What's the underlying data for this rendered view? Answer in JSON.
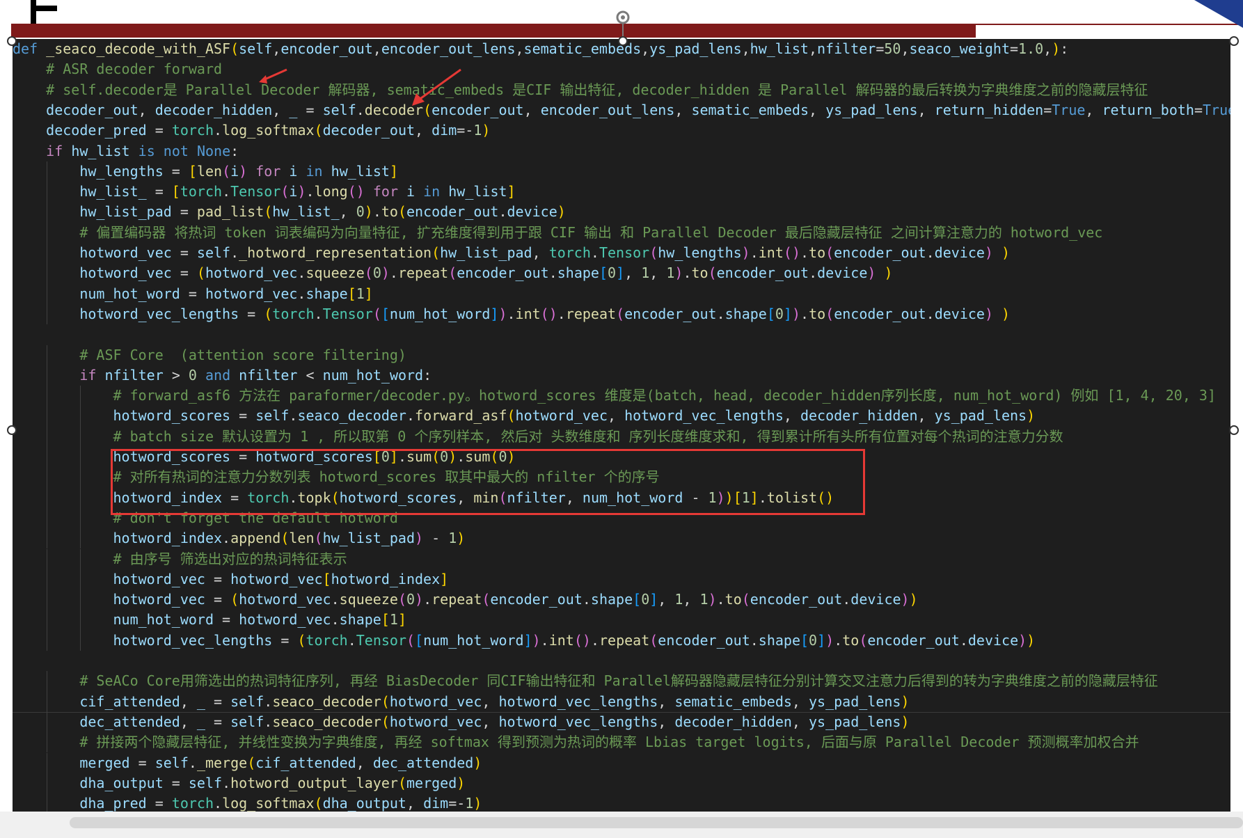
{
  "window": {
    "title_glyph": "F"
  },
  "code": {
    "lines": [
      {
        "text": "def _seaco_decode_with_ASF(self,encoder_out,encoder_out_lens,sematic_embeds,ys_pad_lens,hw_list,nfilter=50,seaco_weight=1.0,):"
      },
      {
        "text": "    # ASR decoder forward"
      },
      {
        "text": "    # self.decoder是 Parallel Decoder 解码器, sematic_embeds 是CIF 输出特征, decoder_hidden 是 Parallel 解码器的最后转换为字典维度之前的隐藏层特征"
      },
      {
        "text": "    decoder_out, decoder_hidden, _ = self.decoder(encoder_out, encoder_out_lens, sematic_embeds, ys_pad_lens, return_hidden=True, return_both=True)"
      },
      {
        "text": "    decoder_pred = torch.log_softmax(decoder_out, dim=-1)"
      },
      {
        "text": "    if hw_list is not None:"
      },
      {
        "text": "        hw_lengths = [len(i) for i in hw_list]"
      },
      {
        "text": "        hw_list_ = [torch.Tensor(i).long() for i in hw_list]"
      },
      {
        "text": "        hw_list_pad = pad_list(hw_list_, 0).to(encoder_out.device)"
      },
      {
        "text": "        # 偏置编码器 将热词 token 词表编码为向量特征, 扩充维度得到用于跟 CIF 输出 和 Parallel Decoder 最后隐藏层特征 之间计算注意力的 hotword_vec"
      },
      {
        "text": "        hotword_vec = self._hotword_representation(hw_list_pad, torch.Tensor(hw_lengths).int().to(encoder_out.device) )"
      },
      {
        "text": "        hotword_vec = (hotword_vec.squeeze(0).repeat(encoder_out.shape[0], 1, 1).to(encoder_out.device) )"
      },
      {
        "text": "        num_hot_word = hotword_vec.shape[1]"
      },
      {
        "text": "        hotword_vec_lengths = (torch.Tensor([num_hot_word]).int().repeat(encoder_out.shape[0]).to(encoder_out.device) )"
      },
      {
        "text": ""
      },
      {
        "text": "        # ASF Core  (attention score filtering)"
      },
      {
        "text": "        if nfilter > 0 and nfilter < num_hot_word:"
      },
      {
        "text": "            # forward_asf6 方法在 paraformer/decoder.py。hotword_scores 维度是(batch, head, decoder_hidden序列长度, num_hot_word) 例如 [1, 4, 20, 3]"
      },
      {
        "text": "            hotword_scores = self.seaco_decoder.forward_asf(hotword_vec, hotword_vec_lengths, decoder_hidden, ys_pad_lens)"
      },
      {
        "text": "            # batch size 默认设置为 1 , 所以取第 0 个序列样本, 然后对 头数维度和 序列长度维度求和, 得到累计所有头所有位置对每个热词的注意力分数"
      },
      {
        "text": "            hotword_scores = hotword_scores[0].sum(0).sum(0)"
      },
      {
        "text": "            # 对所有热词的注意力分数列表 hotword_scores 取其中最大的 nfilter 个的序号"
      },
      {
        "text": "            hotword_index = torch.topk(hotword_scores, min(nfilter, num_hot_word - 1))[1].tolist()"
      },
      {
        "text": "            # don't forget the default hotword"
      },
      {
        "text": "            hotword_index.append(len(hw_list_pad) - 1)"
      },
      {
        "text": "            # 由序号 筛选出对应的热词特征表示"
      },
      {
        "text": "            hotword_vec = hotword_vec[hotword_index]"
      },
      {
        "text": "            hotword_vec = (hotword_vec.squeeze(0).repeat(encoder_out.shape[0], 1, 1).to(encoder_out.device))"
      },
      {
        "text": "            num_hot_word = hotword_vec.shape[1]"
      },
      {
        "text": "            hotword_vec_lengths = (torch.Tensor([num_hot_word]).int().repeat(encoder_out.shape[0]).to(encoder_out.device))"
      },
      {
        "text": ""
      },
      {
        "text": "        # SeACo Core用筛选出的热词特征序列, 再经 BiasDecoder 同CIF输出特征和 Parallel解码器隐藏层特征分别计算交叉注意力后得到的转为字典维度之前的隐藏层特征"
      },
      {
        "text": "        cif_attended, _ = self.seaco_decoder(hotword_vec, hotword_vec_lengths, sematic_embeds, ys_pad_lens)"
      },
      {
        "text": "        dec_attended, _ = self.seaco_decoder(hotword_vec, hotword_vec_lengths, decoder_hidden, ys_pad_lens)"
      },
      {
        "text": "        # 拼接两个隐藏层特征, 并线性变换为字典维度, 再经 softmax 得到预测为热词的概率 Lbias target logits, 后面与原 Parallel Decoder 预测概率加权合并"
      },
      {
        "text": "        merged = self._merge(cif_attended, dec_attended)"
      },
      {
        "text": "        dha_output = self.hotword_output_layer(merged)"
      },
      {
        "text": "        dha_pred = torch.log_softmax(dha_output, dim=-1)"
      }
    ]
  },
  "colors": {
    "background": "#1e1e1e",
    "comment": "#6a9955",
    "keyword": "#569cd6",
    "control_keyword": "#c586c0",
    "function": "#dcdcaa",
    "class": "#4ec9b0",
    "number": "#b5cea8",
    "highlight_box": "#e53935",
    "annotation_arrow": "#e53935",
    "top_band": "#7f1a1a"
  }
}
